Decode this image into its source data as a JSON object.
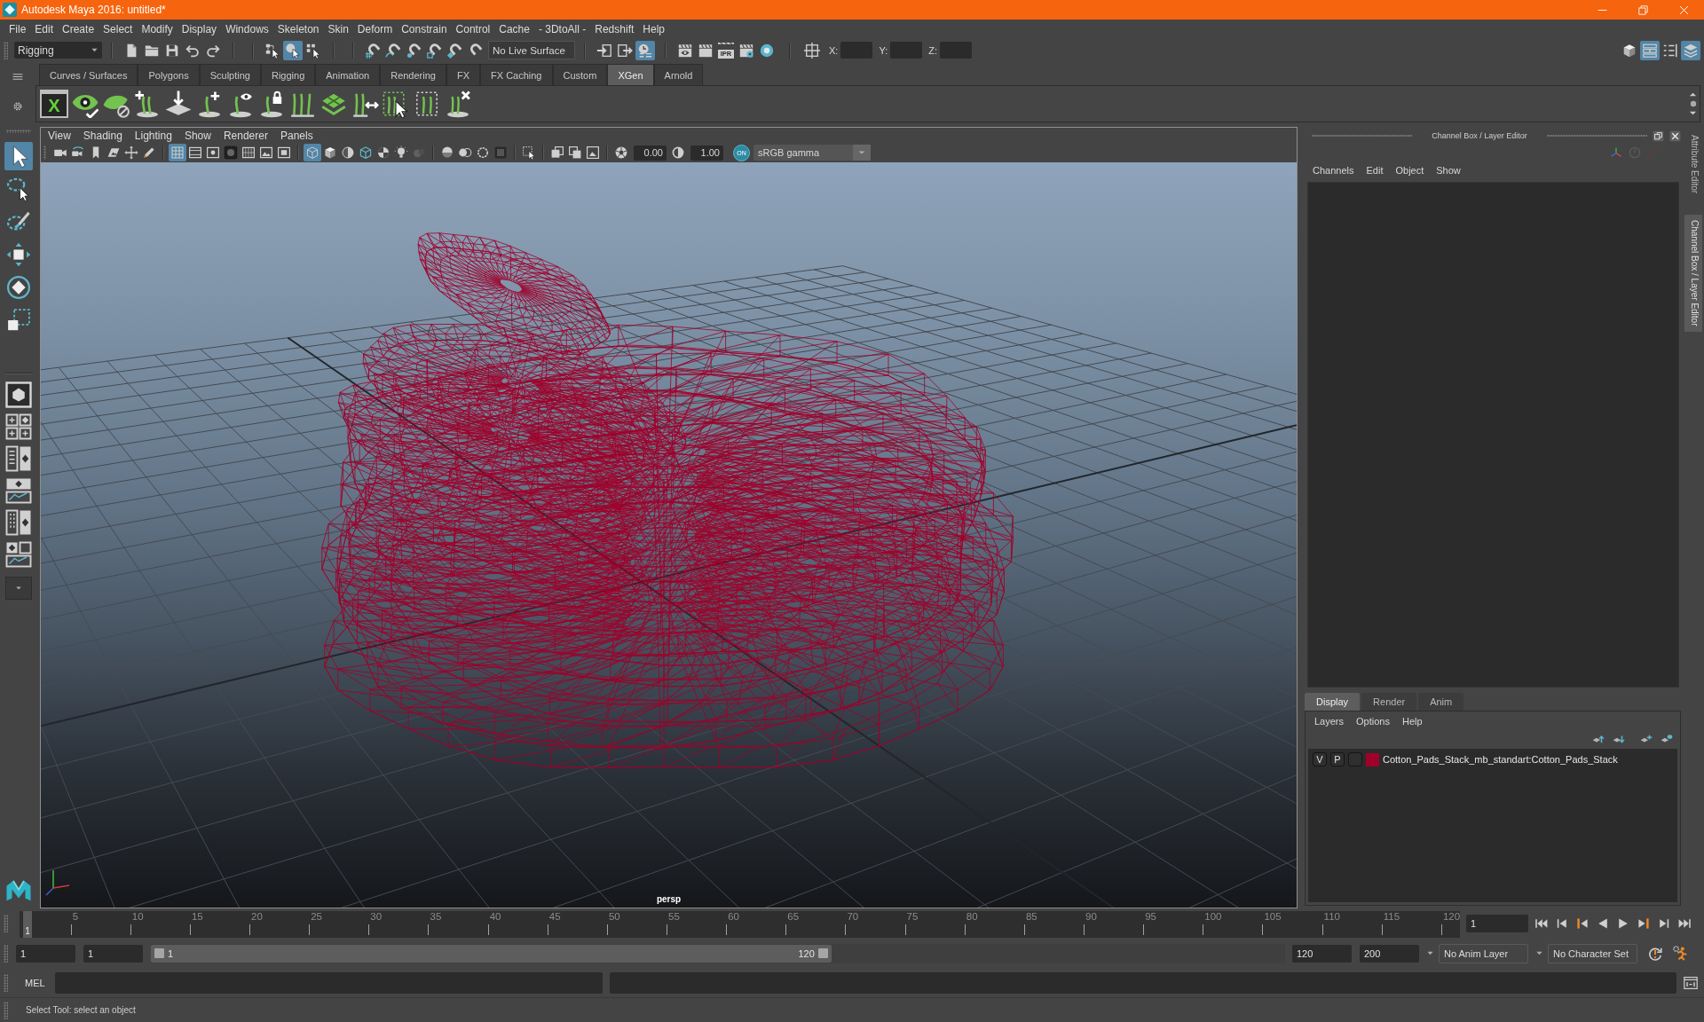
{
  "window": {
    "title": "Autodesk Maya 2016: untitled*"
  },
  "menu_bar": [
    "File",
    "Edit",
    "Create",
    "Select",
    "Modify",
    "Display",
    "Windows",
    "Skeleton",
    "Skin",
    "Deform",
    "Constrain",
    "Control",
    "Cache",
    "- 3DtoAll -",
    "Redshift",
    "Help"
  ],
  "status_line": {
    "menu_set": "Rigging",
    "file_tools": [
      {
        "kind": "new-scene",
        "on": false
      },
      {
        "kind": "open-scene",
        "on": false
      },
      {
        "kind": "save-scene",
        "on": false
      },
      {
        "kind": "undo",
        "on": false
      },
      {
        "kind": "redo",
        "on": false
      }
    ],
    "selection_modes": [
      {
        "kind": "select-hierarchy",
        "on": false
      },
      {
        "kind": "select-object",
        "on": true
      },
      {
        "kind": "select-component",
        "on": false
      }
    ],
    "snap_tools": [
      {
        "kind": "snap-grid",
        "on": false
      },
      {
        "kind": "snap-curve",
        "on": false
      },
      {
        "kind": "snap-point",
        "on": false
      },
      {
        "kind": "snap-view",
        "on": false
      },
      {
        "kind": "snap-surface",
        "on": false
      },
      {
        "kind": "snap-live",
        "on": false
      }
    ],
    "live_surface": "No Live Surface",
    "history_tools": [
      {
        "kind": "input-ops",
        "on": false
      },
      {
        "kind": "output-ops",
        "on": false
      },
      {
        "kind": "history",
        "on": true
      }
    ],
    "render_tools": [
      {
        "kind": "render-view",
        "on": false
      },
      {
        "kind": "render",
        "on": false
      },
      {
        "kind": "render-ipr",
        "label": "IPR",
        "on": false
      },
      {
        "kind": "render-settings",
        "on": false
      },
      {
        "kind": "hypershade",
        "on": false
      }
    ],
    "transform_tools": [
      {
        "kind": "transform-toggle",
        "on": false
      }
    ],
    "coordinates": [
      {
        "label": "X:"
      },
      {
        "label": "Y:"
      },
      {
        "label": "Z:"
      }
    ],
    "panel_toggles": [
      {
        "kind": "modeling-toolkit",
        "on": false
      },
      {
        "kind": "attribute-editor",
        "on": true
      },
      {
        "kind": "tool-settings",
        "on": false
      },
      {
        "kind": "channel-box",
        "on": true
      }
    ]
  },
  "shelf": {
    "tabs": [
      {
        "label": "Curves / Surfaces",
        "selected": false
      },
      {
        "label": "Polygons",
        "selected": false
      },
      {
        "label": "Sculpting",
        "selected": false
      },
      {
        "label": "Rigging",
        "selected": false
      },
      {
        "label": "Animation",
        "selected": false
      },
      {
        "label": "Rendering",
        "selected": false
      },
      {
        "label": "FX",
        "selected": false
      },
      {
        "label": "FX Caching",
        "selected": false
      },
      {
        "label": "Custom",
        "selected": false
      },
      {
        "label": "XGen",
        "selected": true
      },
      {
        "label": "Arnold",
        "selected": false
      }
    ],
    "buttons": [
      {
        "kind": "xgen",
        "label": "X"
      },
      {
        "kind": "eye-check"
      },
      {
        "kind": "leaf-off"
      },
      {
        "kind": "guides-plus"
      },
      {
        "kind": "guides-place"
      },
      {
        "kind": "curve-plus"
      },
      {
        "kind": "curve-eye"
      },
      {
        "kind": "curve-lock"
      },
      {
        "kind": "curves"
      },
      {
        "kind": "tiles"
      },
      {
        "kind": "curves-arrows"
      },
      {
        "kind": "curves-select"
      },
      {
        "kind": "curves-bound"
      },
      {
        "kind": "curves-delete"
      }
    ]
  },
  "toolbox": {
    "tools": [
      {
        "kind": "select",
        "selected": true
      },
      {
        "kind": "lasso",
        "selected": false
      },
      {
        "kind": "paint-select",
        "selected": false
      },
      {
        "kind": "move",
        "selected": false
      },
      {
        "kind": "rotate",
        "selected": false
      },
      {
        "kind": "scale",
        "selected": false
      }
    ],
    "layouts": [
      {
        "kind": "single"
      },
      {
        "kind": "four"
      },
      {
        "kind": "side-by-side"
      },
      {
        "kind": "top-bottom"
      },
      {
        "kind": "three-split"
      },
      {
        "kind": "three-stack"
      }
    ]
  },
  "viewport": {
    "menu": [
      "View",
      "Shading",
      "Lighting",
      "Show",
      "Renderer",
      "Panels"
    ],
    "toolbar_groups": [
      {
        "buttons": [
          {
            "kind": "camera",
            "on": false
          },
          {
            "kind": "camera-lock",
            "on": false
          },
          {
            "kind": "bookmark",
            "on": false
          },
          {
            "kind": "image-plane",
            "on": false
          },
          {
            "kind": "pan-zoom",
            "on": false
          },
          {
            "kind": "grease-pencil",
            "on": false
          }
        ]
      },
      {
        "buttons": [
          {
            "kind": "grid",
            "on": true
          },
          {
            "kind": "film-gate",
            "on": false
          },
          {
            "kind": "resolution-gate",
            "on": false
          },
          {
            "kind": "gate-mask",
            "on": false
          },
          {
            "kind": "field-chart",
            "on": false
          },
          {
            "kind": "safe-action",
            "on": false
          },
          {
            "kind": "safe-title",
            "on": false
          }
        ]
      },
      {
        "buttons": [
          {
            "kind": "wireframe",
            "on": true
          },
          {
            "kind": "smooth-shade",
            "on": false
          },
          {
            "kind": "wire-on-shaded",
            "on": false
          },
          {
            "kind": "textured",
            "on": false
          },
          {
            "kind": "all-lights",
            "on": false
          },
          {
            "kind": "lights",
            "on": false
          },
          {
            "kind": "shadows",
            "on": false
          }
        ]
      },
      {
        "buttons": [
          {
            "kind": "ambient-occlusion",
            "on": false
          },
          {
            "kind": "motion-blur",
            "on": false
          },
          {
            "kind": "anti-alias",
            "on": false
          },
          {
            "kind": "depth-of-field",
            "on": false
          }
        ]
      },
      {
        "buttons": [
          {
            "kind": "isolate",
            "on": false
          }
        ]
      },
      {
        "buttons": [
          {
            "kind": "xray",
            "on": false
          },
          {
            "kind": "xray-joints",
            "on": false
          },
          {
            "kind": "xray-components",
            "on": false
          }
        ]
      },
      {
        "buttons": [
          {
            "kind": "exposure",
            "on": false
          }
        ]
      }
    ],
    "exposure": "0.00",
    "gamma": "1.00",
    "color_management": {
      "label": "ON",
      "on": true
    },
    "color_space": "sRGB gamma",
    "camera_label": "persp"
  },
  "channel_box": {
    "title": "Channel Box / Layer Editor",
    "menu": [
      "Channels",
      "Edit",
      "Object",
      "Show"
    ]
  },
  "layer_editor": {
    "tabs": [
      {
        "label": "Display",
        "selected": true
      },
      {
        "label": "Render",
        "selected": false
      },
      {
        "label": "Anim",
        "selected": false
      }
    ],
    "menu": [
      "Layers",
      "Options",
      "Help"
    ],
    "layers": [
      {
        "visibility": "V",
        "playback": "P",
        "color": "#a0002a",
        "name": "Cotton_Pads_Stack_mb_standart:Cotton_Pads_Stack"
      }
    ]
  },
  "side_tabs": [
    {
      "label": "Attribute Editor",
      "selected": false
    },
    {
      "label": "Channel Box / Layer Editor",
      "selected": true
    }
  ],
  "time_slider": {
    "ticks": [
      "5",
      "10",
      "15",
      "20",
      "25",
      "30",
      "35",
      "40",
      "45",
      "50",
      "55",
      "60",
      "65",
      "70",
      "75",
      "80",
      "85",
      "90",
      "95",
      "100",
      "105",
      "110",
      "115",
      "120"
    ],
    "playhead": "1",
    "level": 0,
    "current_frame": "1",
    "playback": [
      {
        "kind": "go-start"
      },
      {
        "kind": "step-back"
      },
      {
        "kind": "prev-key"
      },
      {
        "kind": "play-back"
      },
      {
        "kind": "play-forward"
      },
      {
        "kind": "next-key"
      },
      {
        "kind": "step-forward"
      },
      {
        "kind": "go-end"
      }
    ]
  },
  "range_slider": {
    "animation_start": "1",
    "playback_start": "1",
    "range_start": "1",
    "range_end": "120",
    "level": 0.6,
    "playback_end": "120",
    "animation_end": "200",
    "anim_layer": "No Anim Layer",
    "character_set": "No Character Set"
  },
  "command_line": {
    "language": "MEL"
  },
  "help_line": "Select Tool: select an object"
}
